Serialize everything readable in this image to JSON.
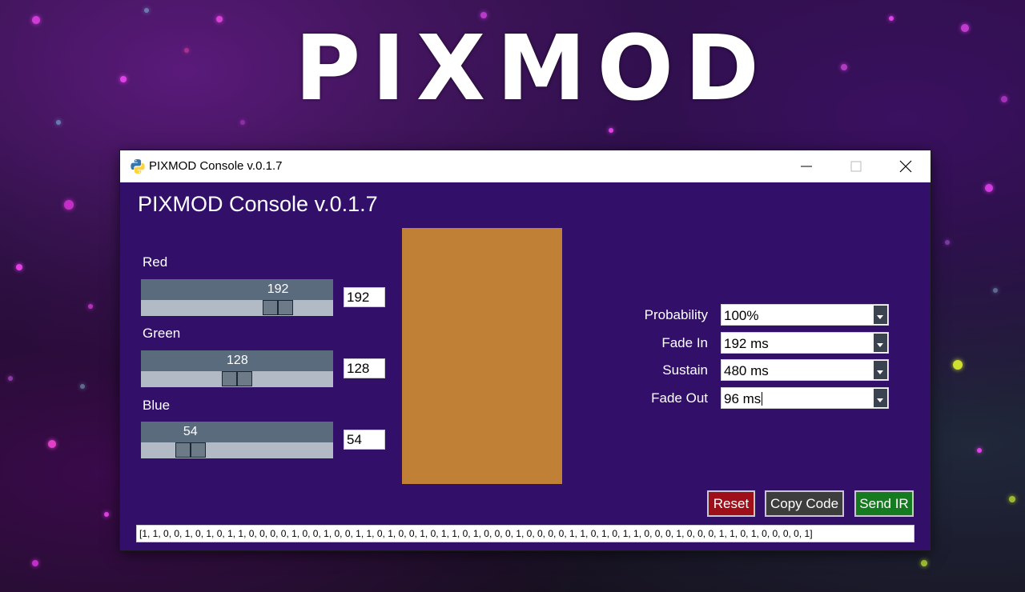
{
  "background": {
    "logo_text": "PIXMOD"
  },
  "window": {
    "title": "PIXMOD Console v.0.1.7",
    "icon": "python-icon",
    "controls": {
      "minimize": "minimize-icon",
      "maximize": "maximize-icon",
      "close": "close-icon"
    }
  },
  "console": {
    "heading": "PIXMOD Console v.0.1.7",
    "sliders": [
      {
        "label": "Red",
        "value": "192",
        "level": 192,
        "max": 255
      },
      {
        "label": "Green",
        "value": "128",
        "level": 128,
        "max": 255
      },
      {
        "label": "Blue",
        "value": "54",
        "level": 54,
        "max": 255
      }
    ],
    "preview_color": "#c08036",
    "options": [
      {
        "label": "Probability",
        "value": "100%"
      },
      {
        "label": "Fade In",
        "value": "192 ms"
      },
      {
        "label": "Sustain",
        "value": "480 ms"
      },
      {
        "label": "Fade Out",
        "value": "96 ms"
      }
    ],
    "buttons": {
      "reset": "Reset",
      "copy": "Copy Code",
      "send": "Send IR"
    },
    "code": "[1, 1, 0, 0, 1, 0, 1, 0, 1, 1, 0, 0, 0, 0, 1, 0, 0, 1, 0, 0, 1, 1, 0, 1, 0, 0, 1, 0, 1, 1, 0, 1, 0, 0, 0, 1, 0, 0, 0, 0, 1, 1, 0, 1, 0, 1, 1, 0, 0, 0, 1, 0, 0, 0, 1, 1, 0, 1, 0, 0, 0, 0, 1]"
  },
  "colors": {
    "window_bg": "#32106a",
    "reset": "#9e0f1a",
    "copy": "#3d3d3d",
    "send": "#167a20"
  }
}
